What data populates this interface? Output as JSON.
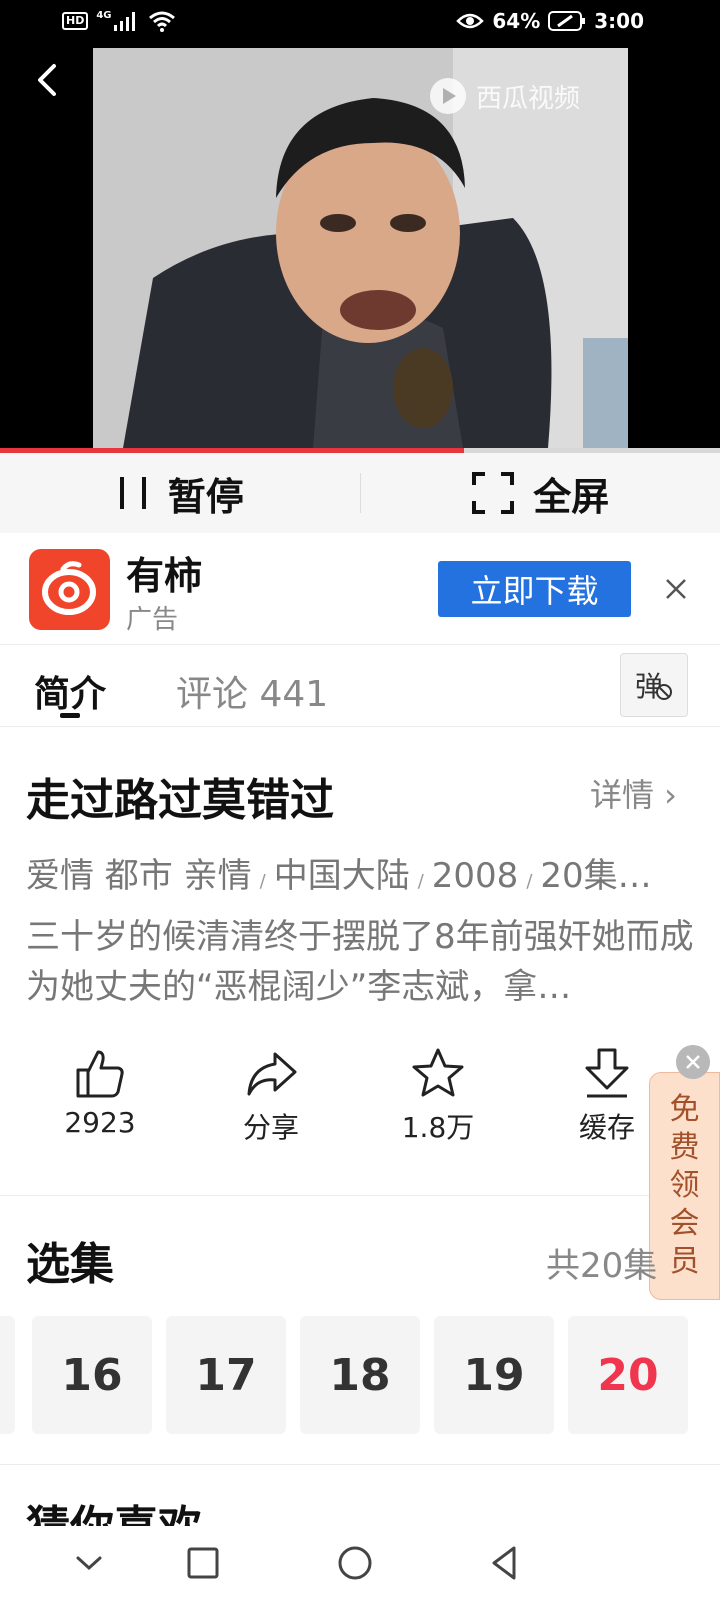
{
  "status_bar": {
    "hd_badge": "HD",
    "network": "4G",
    "battery": "64%",
    "time": "3:00"
  },
  "video": {
    "watermark": "西瓜视频",
    "progress_fraction": 0.645
  },
  "controls": {
    "pause_label": "暂停",
    "fullscreen_label": "全屏"
  },
  "ad": {
    "app_name": "有柿",
    "label": "广告",
    "download_label": "立即下载"
  },
  "tabs": {
    "intro": "简介",
    "comments": "评论 441",
    "danmu": "弹"
  },
  "show": {
    "title": "走过路过莫错过",
    "details_link": "详情 ›",
    "genres": "爱情 都市 亲情",
    "region": "中国大陆",
    "year": "2008",
    "episodes_meta": "20集…",
    "description": "三十岁的候清清终于摆脱了8年前强奸她而成为她丈夫的“恶棍阔少”李志斌，拿…"
  },
  "actions": {
    "like_count": "2923",
    "share_label": "分享",
    "favorite_count": "1.8万",
    "cache_label": "缓存"
  },
  "promo": {
    "chars": [
      "免",
      "费",
      "领",
      "会",
      "员"
    ]
  },
  "episodes": {
    "title": "选集",
    "total": "共20集",
    "items": [
      "16",
      "17",
      "18",
      "19",
      "20"
    ],
    "current": "20"
  },
  "next_section_heading": "猜你喜欢",
  "colors": {
    "accent_red": "#e7373e",
    "download_blue": "#2372df",
    "active_episode": "#f0354e"
  }
}
